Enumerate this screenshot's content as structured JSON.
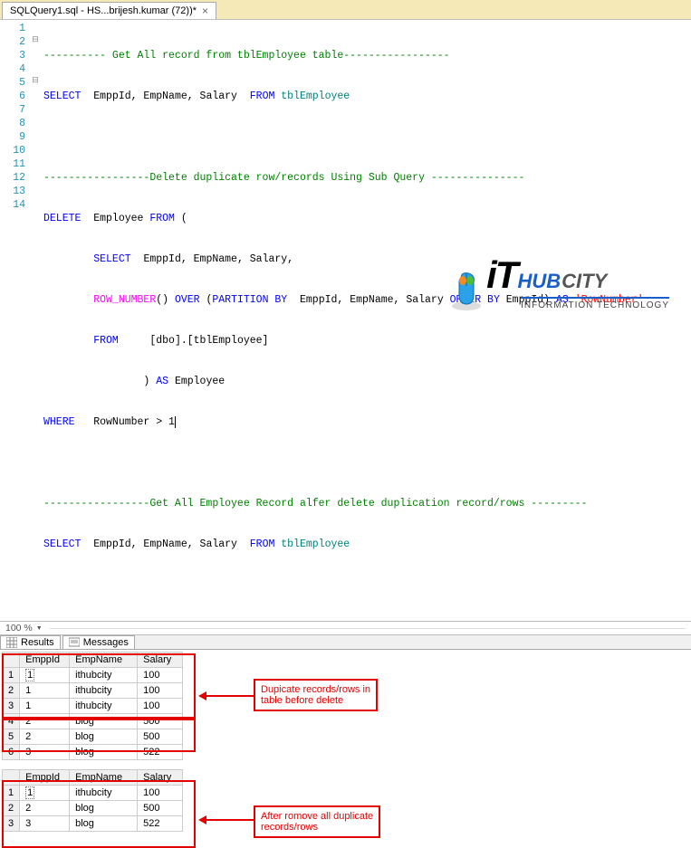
{
  "tab": {
    "title": "SQLQuery1.sql - HS...brijesh.kumar (72))*",
    "close": "×"
  },
  "code": {
    "l1": {
      "c": "---------- Get All record from tblEmployee table-----------------"
    },
    "l2": {
      "k1": "SELECT",
      "t1": "  EmppId, EmpName, Salary  ",
      "k2": "FROM",
      "id": " tblEmployee"
    },
    "l3": {
      "t": ""
    },
    "l4": {
      "c": "-----------------Delete duplicate row/records Using Sub Query ---------------"
    },
    "l5": {
      "k1": "DELETE",
      "t1": "  Employee ",
      "k2": "FROM ",
      "p": "("
    },
    "l6": {
      "k1": "SELECT",
      "t1": "  EmppId, EmpName, Salary,"
    },
    "l7": {
      "f1": "ROW_NUMBER",
      "p1": "() ",
      "k1": "OVER ",
      "p2": "(",
      "k2": "PARTITION BY",
      "t1": "  EmppId, EmpName, Salary ",
      "k3": "ORDER BY",
      "t2": " EmppId",
      "p3": ") ",
      "k4": "AS ",
      "s": "'RowNumber'"
    },
    "l8": {
      "k1": "FROM",
      "t1": "     [dbo].[tblEmployee]"
    },
    "l9": {
      "p1": ") ",
      "k1": "AS",
      "t1": " Employee"
    },
    "l10": {
      "k1": "WHERE",
      "t1": "   RowNumber > 1"
    },
    "l11": {
      "t": ""
    },
    "l12": {
      "c": "-----------------Get All Employee Record alfer delete duplication record/rows ---------"
    },
    "l13": {
      "k1": "SELECT",
      "t1": "  EmppId, EmpName, Salary  ",
      "k2": "FROM",
      "id": " tblEmployee"
    }
  },
  "zoom": "100 %",
  "tabs2": {
    "results": "Results",
    "messages": "Messages"
  },
  "grid": {
    "headers": {
      "emp": "EmppId",
      "name": "EmpName",
      "sal": "Salary"
    },
    "before": [
      {
        "n": "1",
        "emp": "1",
        "name": "ithubcity",
        "sal": "100"
      },
      {
        "n": "2",
        "emp": "1",
        "name": "ithubcity",
        "sal": "100"
      },
      {
        "n": "3",
        "emp": "1",
        "name": "ithubcity",
        "sal": "100"
      },
      {
        "n": "4",
        "emp": "2",
        "name": "blog",
        "sal": "500"
      },
      {
        "n": "5",
        "emp": "2",
        "name": "blog",
        "sal": "500"
      },
      {
        "n": "6",
        "emp": "3",
        "name": "blog",
        "sal": "522"
      }
    ],
    "after": [
      {
        "n": "1",
        "emp": "1",
        "name": "ithubcity",
        "sal": "100"
      },
      {
        "n": "2",
        "emp": "2",
        "name": "blog",
        "sal": "500"
      },
      {
        "n": "3",
        "emp": "3",
        "name": "blog",
        "sal": "522"
      }
    ]
  },
  "annot": {
    "dup": "Dupicate records/rows in\ntable before delete",
    "after": "After romove all duplicate\nrecords/rows"
  },
  "logo": {
    "hub": "HUB",
    "city": " CITY",
    "sub": "INFORMATION TECHNOLOGY",
    "it": "iT"
  }
}
